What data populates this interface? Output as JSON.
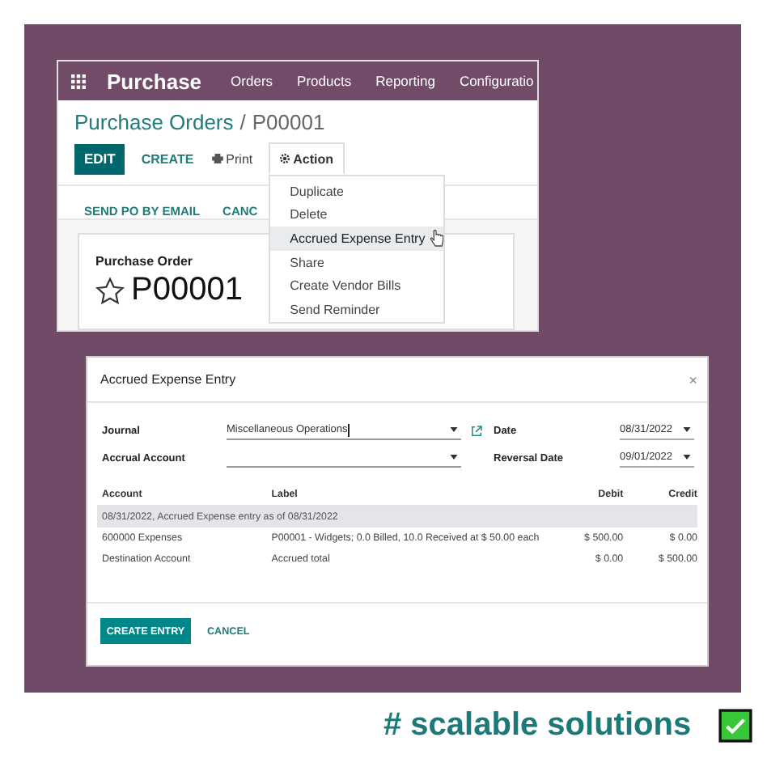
{
  "app_bar": {
    "app_name": "Purchase",
    "menu": [
      "Orders",
      "Products",
      "Reporting",
      "Configuratio"
    ]
  },
  "breadcrumb": {
    "parent": "Purchase Orders",
    "separator": "/",
    "current": "P00001"
  },
  "toolbar": {
    "edit": "EDIT",
    "create": "CREATE",
    "print": "Print"
  },
  "action_menu": {
    "label": "Action",
    "expanded": true,
    "items": [
      {
        "label": "Duplicate",
        "selected": false
      },
      {
        "label": "Delete",
        "selected": false
      },
      {
        "label": "Accrued Expense Entry",
        "selected": true
      },
      {
        "label": "Share",
        "selected": false
      },
      {
        "label": "Create Vendor Bills",
        "selected": false
      },
      {
        "label": "Send Reminder",
        "selected": false
      }
    ]
  },
  "status_buttons": [
    "SEND PO BY EMAIL",
    "CANC"
  ],
  "record": {
    "type_label": "Purchase Order",
    "name": "P00001",
    "starred": false
  },
  "dialog": {
    "title": "Accrued Expense Entry",
    "close": "×",
    "left_fields": [
      {
        "label": "Journal",
        "value": "Miscellaneous Operations",
        "external_link": true
      },
      {
        "label": "Accrual Account",
        "external_link": false
      }
    ],
    "right_fields": [
      {
        "label": "Date",
        "value": "08/31/2022"
      },
      {
        "label": "Reversal Date",
        "value": "09/01/2022"
      }
    ],
    "columns": [
      "Account",
      "Label",
      "Debit",
      "Credit"
    ],
    "group_row": "08/31/2022, Accrued Expense entry as of 08/31/2022",
    "rows": [
      {
        "account": "600000 Expenses",
        "label": "P00001 - Widgets; 0.0 Billed, 10.0 Received at $ 50.00 each",
        "debit": "$ 500.00",
        "credit": "$ 0.00"
      },
      {
        "account": "Destination Account",
        "label": "Accrued total",
        "debit": "$ 0.00",
        "credit": "$ 500.00"
      }
    ],
    "primary_button": "CREATE ENTRY",
    "secondary_button": "CANCEL"
  },
  "tagline": {
    "text": "# scalable solutions",
    "checked": true
  }
}
